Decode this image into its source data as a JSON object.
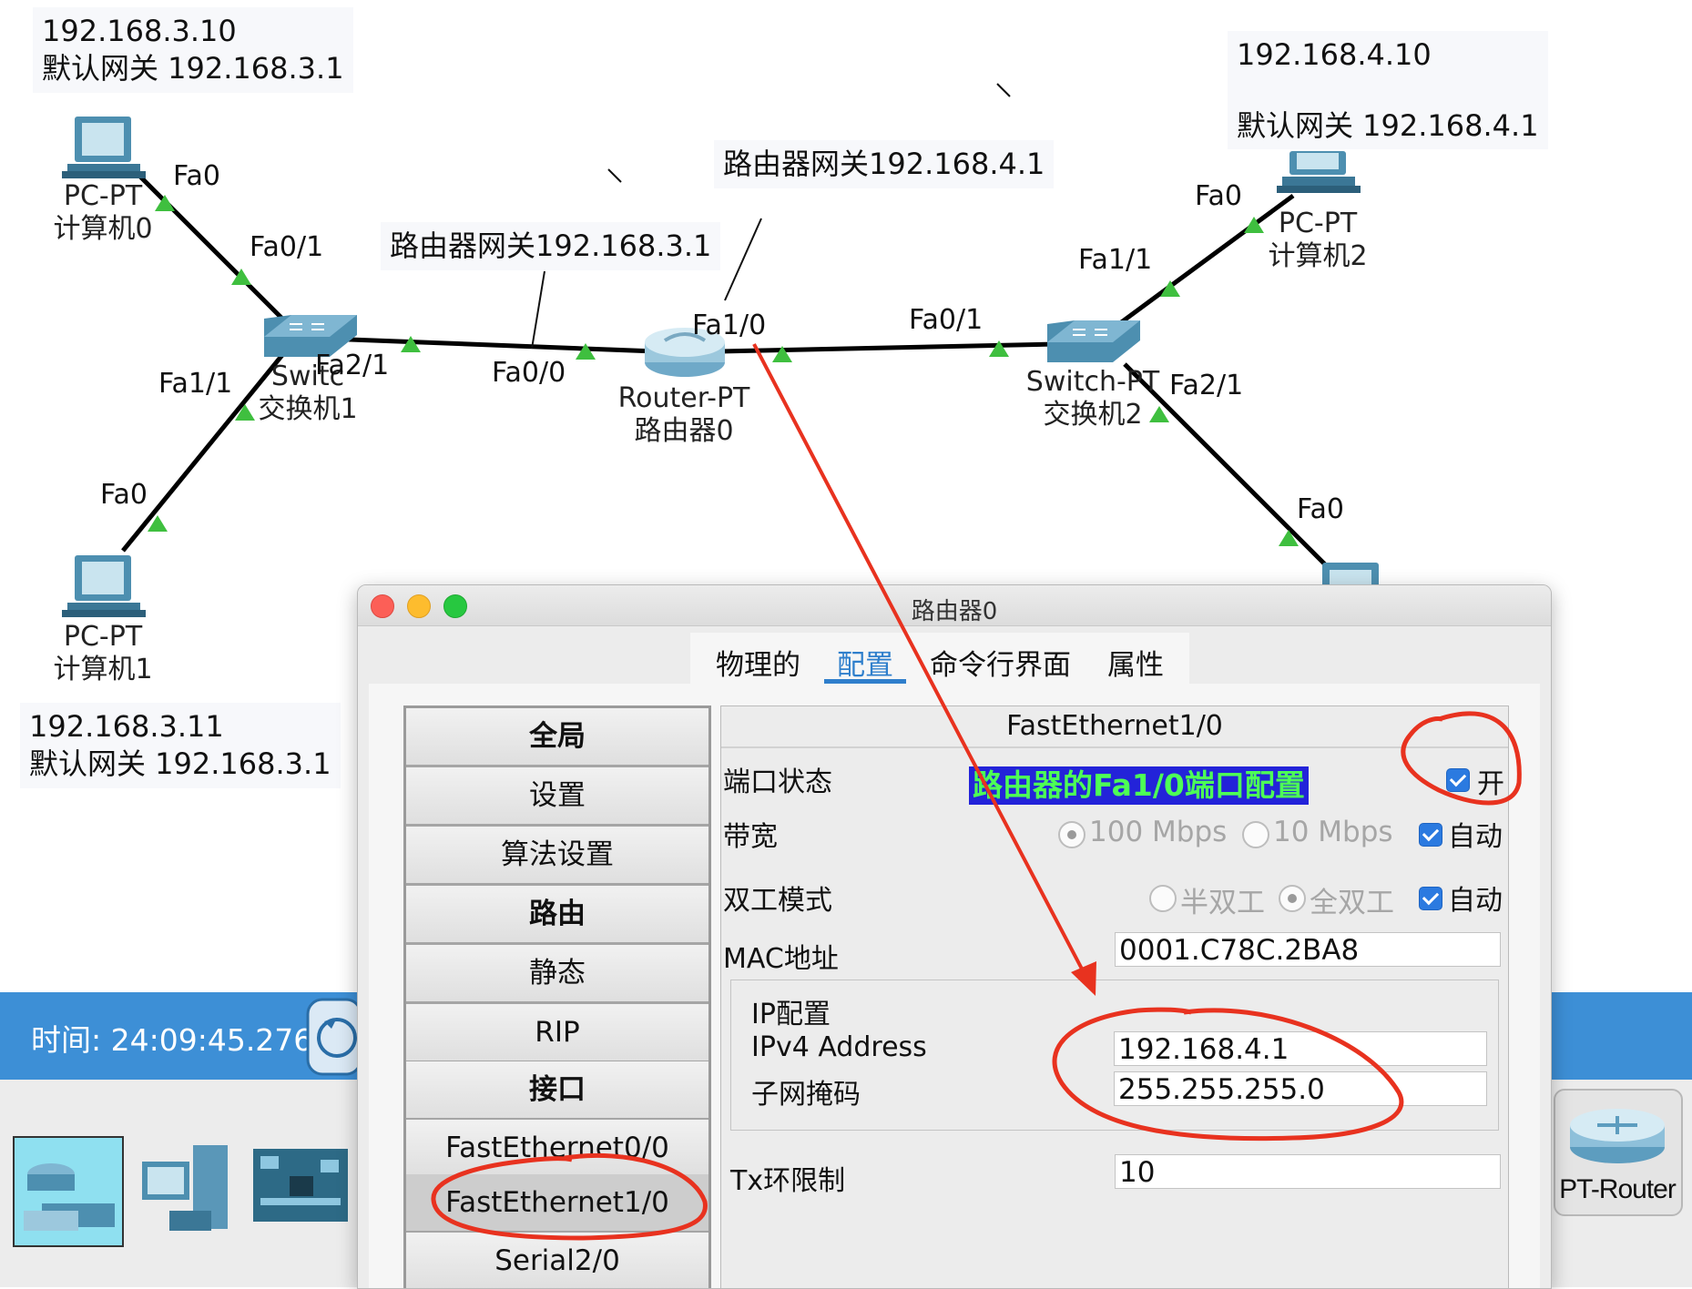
{
  "topology": {
    "notes": {
      "pc0": {
        "ip": "192.168.3.10",
        "gateway": "默认网关 192.168.3.1"
      },
      "pc1": {
        "ip": "192.168.3.11",
        "gateway": "默认网关 192.168.3.1"
      },
      "pc2": {
        "ip": "192.168.4.10",
        "gateway": "默认网关 192.168.4.1"
      },
      "router_gw3": "路由器网关192.168.3.1",
      "router_gw4": "路由器网关192.168.4.1"
    },
    "devices": {
      "pc0": {
        "model": "PC-PT",
        "name": "计算机0"
      },
      "pc1": {
        "model": "PC-PT",
        "name": "计算机1"
      },
      "pc2": {
        "model": "PC-PT",
        "name": "计算机2"
      },
      "switch1": {
        "model": "Switc",
        "name": "交换机1"
      },
      "switch2": {
        "model": "Switch-PT",
        "name": "交换机2"
      },
      "router0": {
        "model": "Router-PT",
        "name": "路由器0"
      }
    },
    "ports": {
      "pc0_fa0": "Fa0",
      "sw1_fa01": "Fa0/1",
      "sw1_fa11": "Fa1/1",
      "sw1_fa21": "Fa2/1",
      "pc1_fa0": "Fa0",
      "r0_fa00": "Fa0/0",
      "r0_fa10": "Fa1/0",
      "sw2_fa01": "Fa0/1",
      "sw2_fa11": "Fa1/1",
      "sw2_fa21": "Fa2/1",
      "pc2_fa0": "Fa0",
      "pc3_fa0": "Fa0"
    }
  },
  "status_bar": {
    "time": "时间: 24:09:45.276"
  },
  "dock": {
    "pt_router_label": "PT-Router"
  },
  "dialog": {
    "title": "路由器0",
    "tabs": [
      {
        "label": "物理的"
      },
      {
        "label": "配置"
      },
      {
        "label": "命令行界面"
      },
      {
        "label": "属性"
      }
    ],
    "active_tab": "配置",
    "sidebar": [
      {
        "label": "全局"
      },
      {
        "label": "设置"
      },
      {
        "label": "算法设置"
      },
      {
        "label": "路由"
      },
      {
        "label": "静态"
      },
      {
        "label": "RIP"
      },
      {
        "label": "接口"
      },
      {
        "label": "FastEthernet0/0"
      },
      {
        "label": "FastEthernet1/0"
      },
      {
        "label": "Serial2/0"
      }
    ],
    "selected_interface": "FastEthernet1/0",
    "panel": {
      "title": "FastEthernet1/0",
      "port_status_label": "端口状态",
      "port_on_label": "开",
      "port_on": true,
      "annotation": "路由器的Fa1/0端口配置",
      "bandwidth_label": "带宽",
      "bw_100": "100 Mbps",
      "bw_10": "10 Mbps",
      "bw_auto": "自动",
      "duplex_label": "双工模式",
      "half_duplex": "半双工",
      "full_duplex": "全双工",
      "duplex_auto": "自动",
      "mac_label": "MAC地址",
      "mac_value": "0001.C78C.2BA8",
      "ip_group_label": "IP配置",
      "ipv4_label": "IPv4 Address",
      "ipv4_value": "192.168.4.1",
      "mask_label": "子网掩码",
      "mask_value": "255.255.255.0",
      "tx_label": "Tx环限制",
      "tx_value": "10"
    }
  },
  "colors": {
    "accent_blue": "#2f7fcc",
    "status_bar": "#3d8fd6",
    "link_up": "#3fbf3f",
    "annotation_red": "#e8321f",
    "highlight_bg": "#2323d9",
    "highlight_text": "#4dff56"
  }
}
